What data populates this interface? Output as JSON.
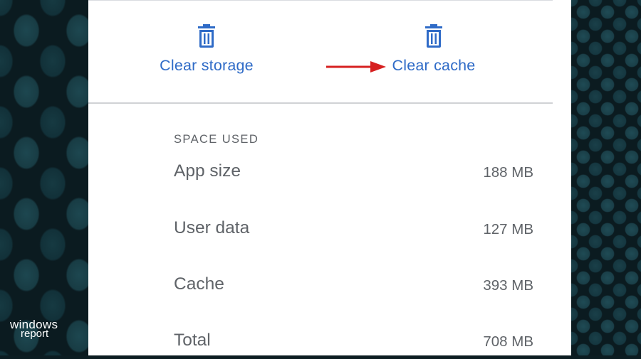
{
  "actions": {
    "clear_storage": {
      "label": "Clear storage",
      "icon": "trash-icon"
    },
    "clear_cache": {
      "label": "Clear cache",
      "icon": "trash-icon"
    }
  },
  "annotation": {
    "icon": "red-arrow-pointer",
    "color": "#d62020"
  },
  "space_used": {
    "header": "SPACE USED",
    "rows": [
      {
        "label": "App size",
        "value": "188 MB"
      },
      {
        "label": "User data",
        "value": "127 MB"
      },
      {
        "label": "Cache",
        "value": "393 MB"
      },
      {
        "label": "Total",
        "value": "708 MB"
      }
    ]
  },
  "watermark": {
    "line1": "windows",
    "line2": "report"
  },
  "colors": {
    "accent": "#2f6bc7",
    "text_secondary": "#5f6368",
    "divider": "#d0d2d5",
    "background_dark": "#0b1b20"
  }
}
